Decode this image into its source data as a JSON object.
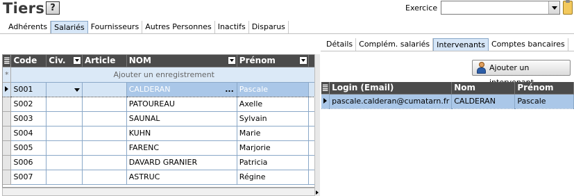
{
  "header": {
    "title": "Tiers",
    "help_label": "?",
    "exercice_label": "Exercice",
    "exercice_value": ""
  },
  "main_tabs": [
    {
      "label": "Adhérents",
      "active": false
    },
    {
      "label": "Salariés",
      "active": true
    },
    {
      "label": "Fournisseurs",
      "active": false
    },
    {
      "label": "Autres Personnes",
      "active": false
    },
    {
      "label": "Inactifs",
      "active": false
    },
    {
      "label": "Disparus",
      "active": false
    }
  ],
  "left_grid": {
    "columns": [
      "Code",
      "Civ.",
      "Article",
      "NOM",
      "Prénom"
    ],
    "add_row_label": "Ajouter un enregistrement",
    "add_row_marker": "*",
    "rows": [
      {
        "code": "S001",
        "civ": "",
        "article": "",
        "nom": "CALDERAN",
        "prenom": "Pascale"
      },
      {
        "code": "S002",
        "civ": "",
        "article": "",
        "nom": "PATOUREAU",
        "prenom": "Axelle"
      },
      {
        "code": "S003",
        "civ": "",
        "article": "",
        "nom": "SAUNAL",
        "prenom": "Sylvain"
      },
      {
        "code": "S004",
        "civ": "",
        "article": "",
        "nom": "KUHN",
        "prenom": "Marie"
      },
      {
        "code": "S005",
        "civ": "",
        "article": "",
        "nom": "FARENC",
        "prenom": "Marjorie"
      },
      {
        "code": "S006",
        "civ": "",
        "article": "",
        "nom": "DAVARD GRANIER",
        "prenom": "Patricia"
      },
      {
        "code": "S007",
        "civ": "",
        "article": "",
        "nom": "ASTRUC",
        "prenom": "Régine"
      }
    ],
    "dots_label": "..."
  },
  "right_tabs": [
    {
      "label": "Détails",
      "active": false
    },
    {
      "label": "Complém. salariés",
      "active": false
    },
    {
      "label": "Intervenants",
      "active": true
    },
    {
      "label": "Comptes bancaires",
      "active": false
    }
  ],
  "add_intervenant_label": "Ajouter un intervenant",
  "right_grid": {
    "columns": [
      "Login (Email)",
      "Nom",
      "Prénom"
    ],
    "rows": [
      {
        "login": "pascale.calderan@cumatarn.fr",
        "nom": "CALDERAN",
        "prenom": "Pascale"
      }
    ]
  },
  "colors": {
    "header_bg": "#4b4b4b",
    "selection_bg": "#aac7e8",
    "active_tab_bg": "#d6e6f7"
  }
}
